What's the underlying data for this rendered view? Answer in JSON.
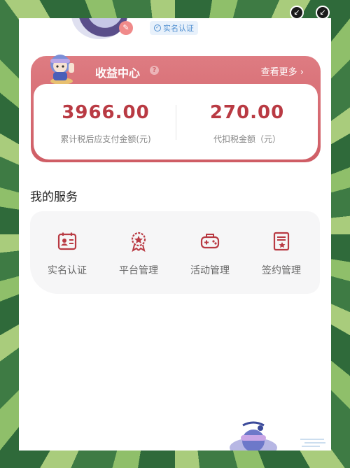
{
  "profile": {
    "verify_label": "实名认证"
  },
  "income": {
    "title": "收益中心",
    "more_label": "查看更多",
    "stats": [
      {
        "value": "3966.00",
        "label": "累计税后应支付金额(元)"
      },
      {
        "value": "270.00",
        "label": "代扣税金额（元）"
      }
    ]
  },
  "services": {
    "title": "我的服务",
    "items": [
      {
        "label": "实名认证",
        "icon": "id-card-icon"
      },
      {
        "label": "平台管理",
        "icon": "award-badge-icon"
      },
      {
        "label": "活动管理",
        "icon": "gamepad-icon"
      },
      {
        "label": "签约管理",
        "icon": "contract-icon"
      }
    ]
  },
  "colors": {
    "accent": "#cf5d65",
    "value_text": "#b93a43",
    "background_green": "#3e7b44"
  }
}
